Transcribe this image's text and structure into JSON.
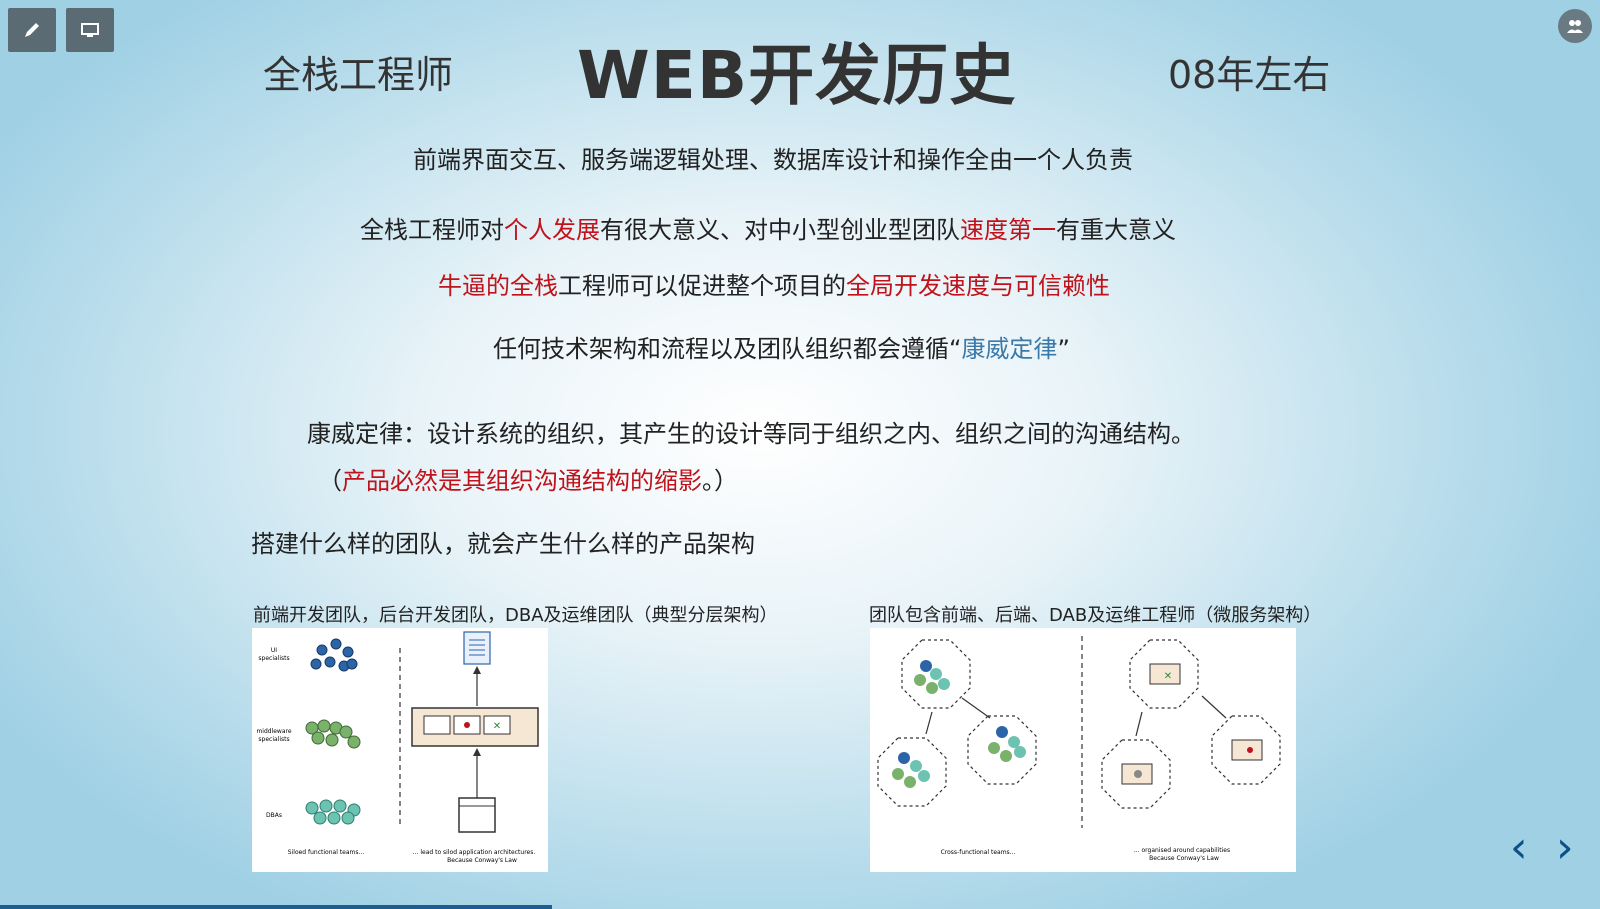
{
  "toolbar": {
    "pen_icon": "pen-icon",
    "screen_icon": "monitor-icon",
    "users_icon": "users-icon"
  },
  "slide": {
    "title": "WEB开发历史",
    "left_label": "全栈工程师",
    "right_label": "08年左右",
    "line1": "前端界面交互、服务端逻辑处理、数据库设计和操作全由一个人负责",
    "line2": {
      "a": "全栈工程师对",
      "b": "个人发展",
      "c": "有很大意义、对中小型创业型团队",
      "d": "速度第一",
      "e": "有重大意义"
    },
    "line3": {
      "a": "牛逼的全栈",
      "b": "工程师可以促进整个项目的",
      "c": "全局开发速度与可信赖性"
    },
    "line4": {
      "a": "任何技术架构和流程以及团队组织都会遵循“",
      "b": "康威定律",
      "c": "”"
    },
    "law": "康威定律：设计系统的组织，其产生的设计等同于组织之内、组织之间的沟通结构。",
    "law_note": {
      "a": "（",
      "b": "产品必然是其组织沟通结构的缩影",
      "c": "。）"
    },
    "team_line": "搭建什么样的团队，就会产生什么样的产品架构",
    "cap_left": "前端开发团队，后台开发团队，DBA及运维团队（典型分层架构）",
    "cap_right": "团队包含前端、后端、DAB及运维工程师（微服务架构）"
  },
  "diagram_left": {
    "ui": "UI",
    "ui2": "specialists",
    "mw": "middleware",
    "mw2": "specialists",
    "dba": "DBAs",
    "foot_l": "Siloed functional teams...",
    "foot_r1": "... lead to silod application architectures.",
    "foot_r2": "Because Conway's Law"
  },
  "diagram_right": {
    "foot_l": "Cross-functional teams...",
    "foot_r1": "... organised around capabilities",
    "foot_r2": "Because Conway's Law"
  },
  "nav": {
    "prev": "‹",
    "next": "›"
  },
  "colors": {
    "red": "#c0121a",
    "blue": "#3a79a8",
    "progress": "#1d5e92"
  }
}
